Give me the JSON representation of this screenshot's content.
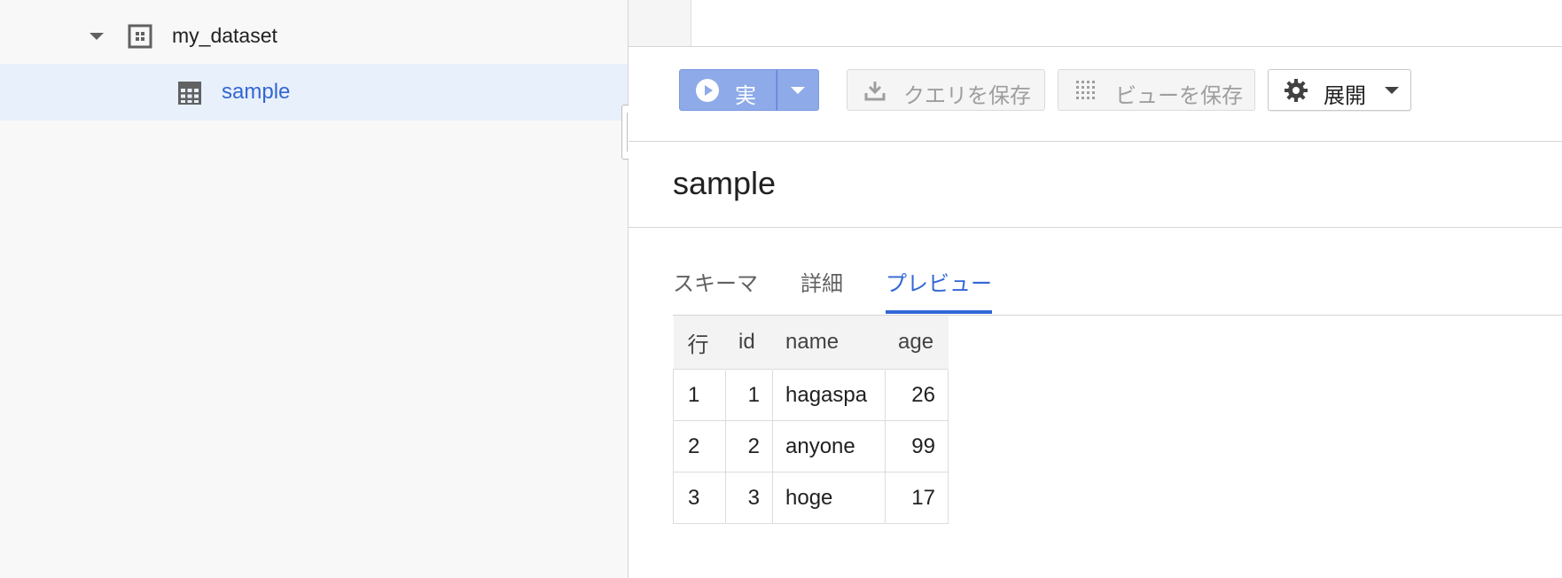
{
  "tree": {
    "dataset_label": "my_dataset",
    "table_label": "sample"
  },
  "toolbar": {
    "run_label": "実行",
    "save_query_label": "クエリを保存",
    "save_view_label": "ビューを保存",
    "expand_label": "展開"
  },
  "page": {
    "title": "sample"
  },
  "tabs": [
    {
      "label": "スキーマ",
      "active": false
    },
    {
      "label": "詳細",
      "active": false
    },
    {
      "label": "プレビュー",
      "active": true
    }
  ],
  "table": {
    "columns": [
      "行",
      "id",
      "name",
      "age"
    ],
    "rows": [
      [
        "1",
        "1",
        "hagaspa",
        "26"
      ],
      [
        "2",
        "2",
        "anyone",
        "99"
      ],
      [
        "3",
        "3",
        "hoge",
        "17"
      ]
    ]
  },
  "colors": {
    "accent": "#3367d6",
    "run_button": "#8eaae8",
    "selected_row": "#e8f0fb"
  }
}
